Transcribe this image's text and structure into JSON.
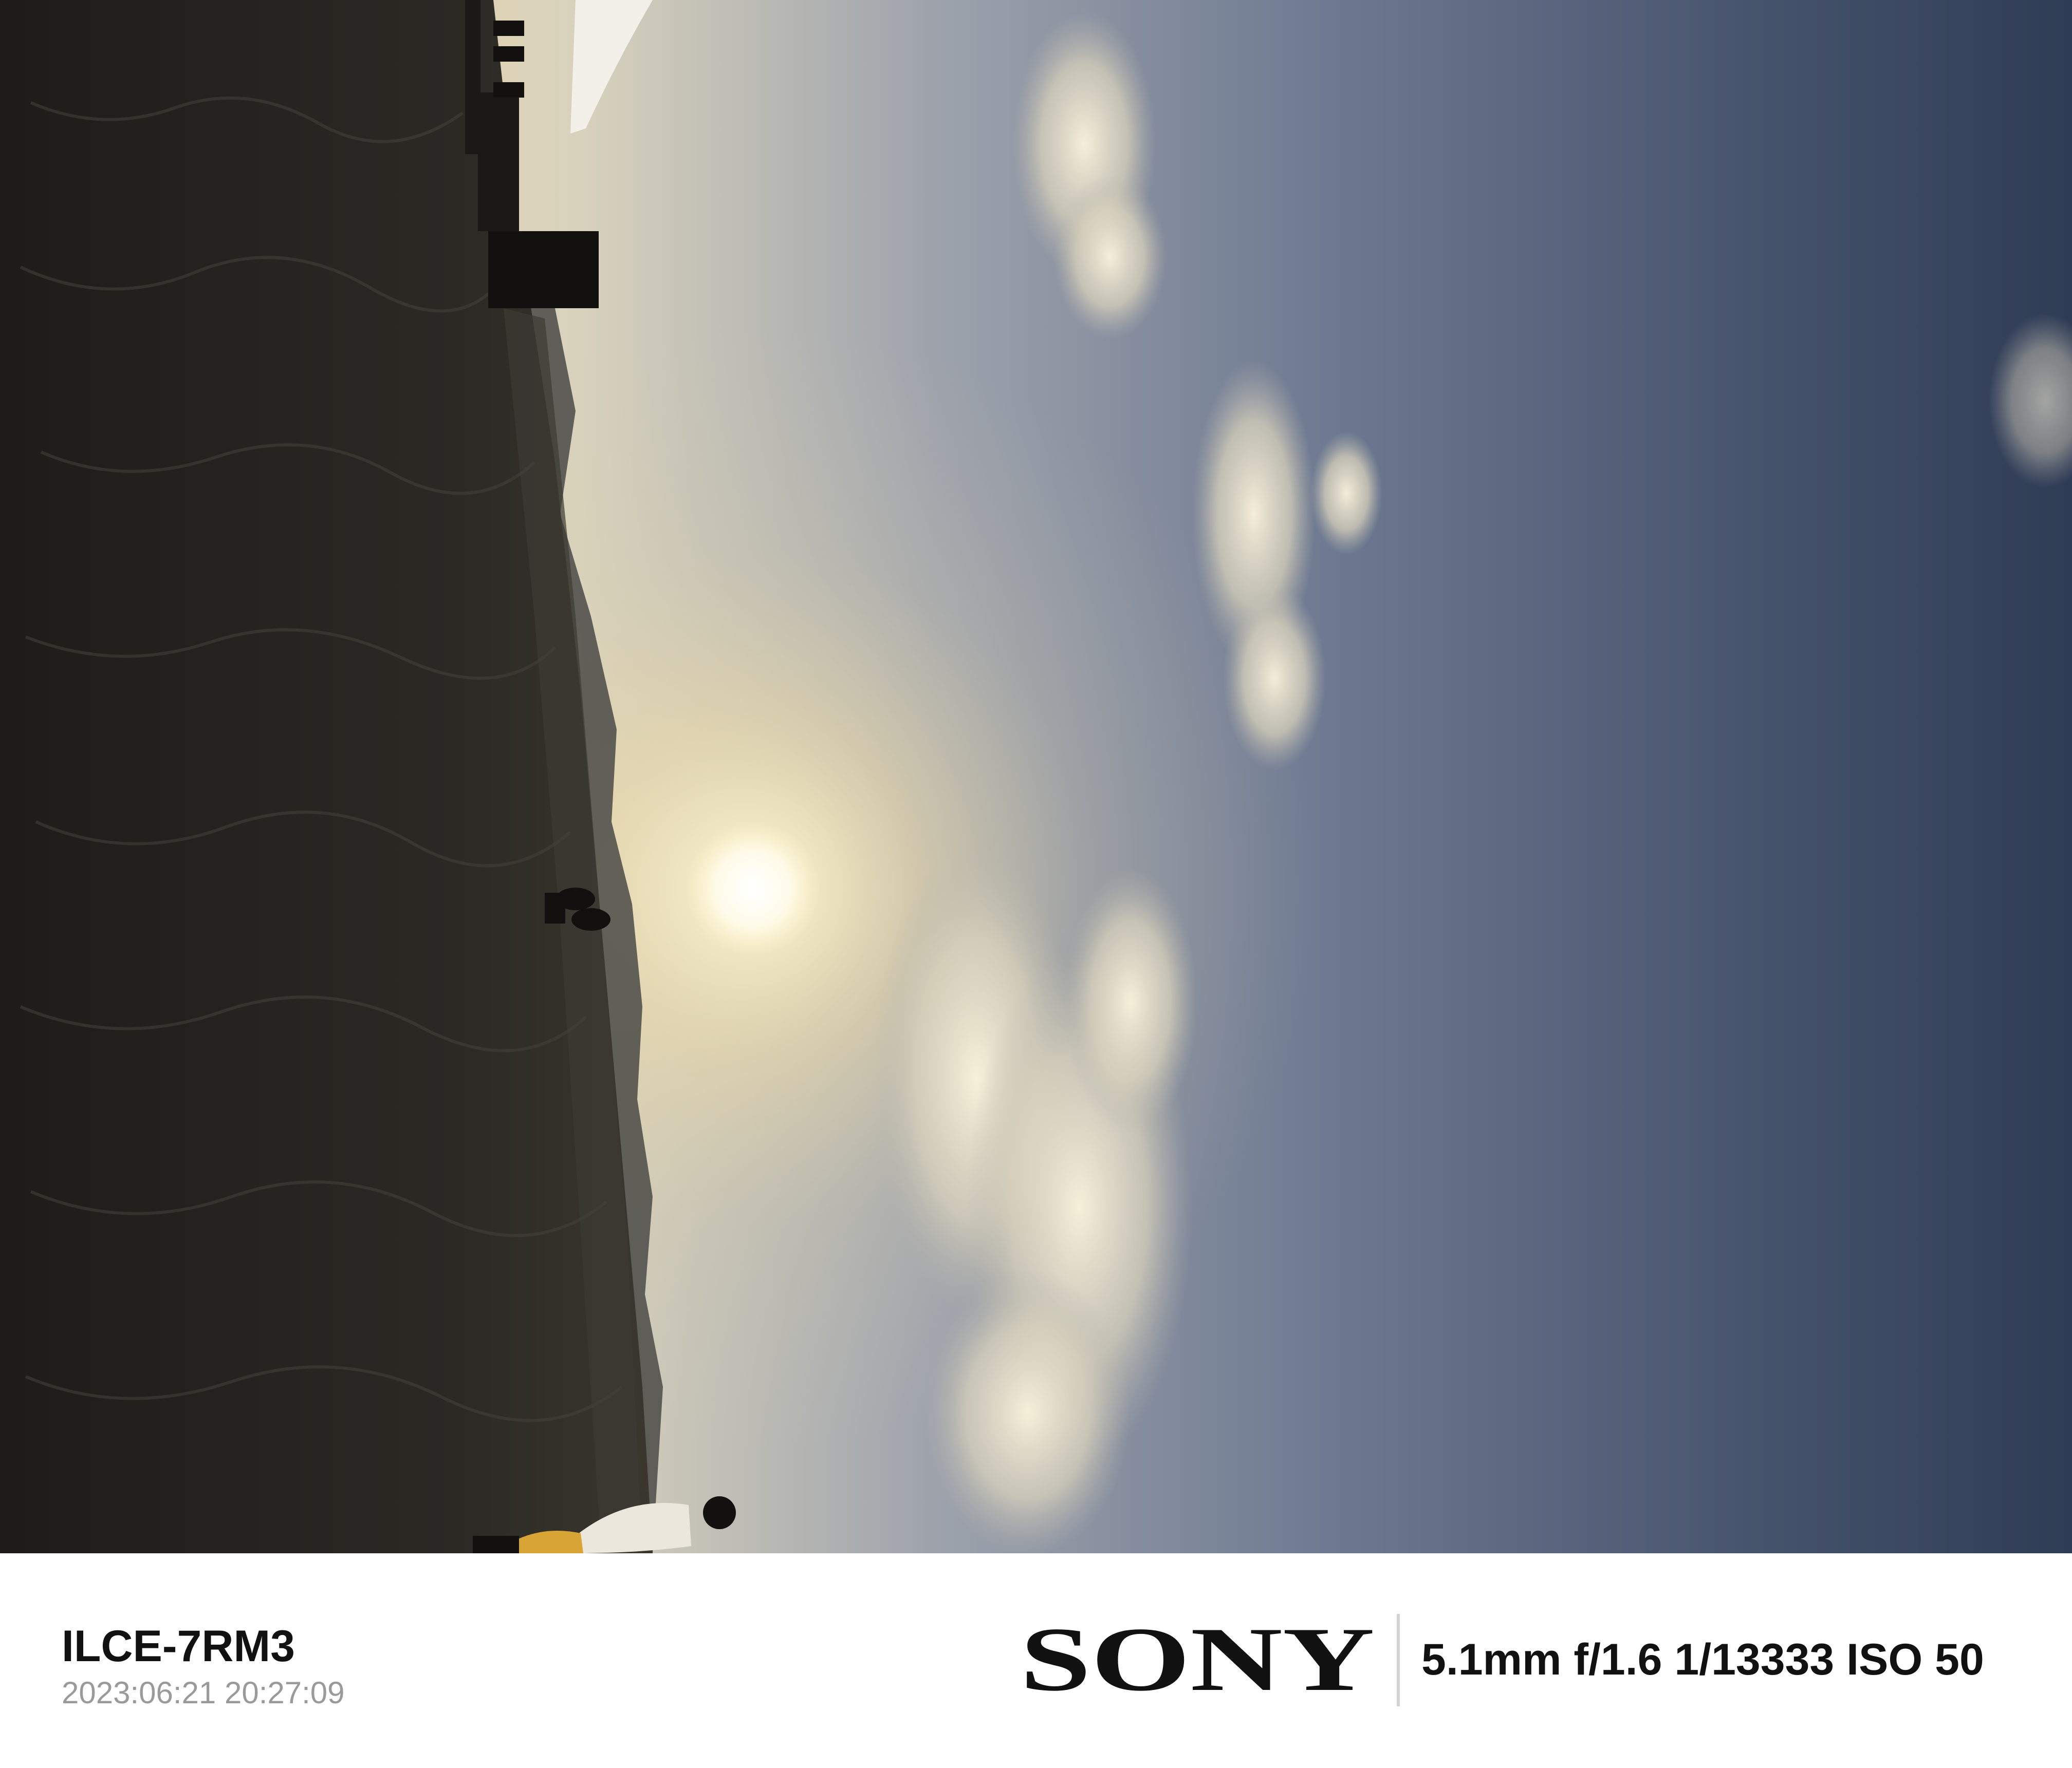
{
  "photo": {
    "scene": "sunset-over-desert-rotated",
    "colors": {
      "sky_dark": "#2d3a52",
      "sky_mid": "#5a6a86",
      "sky_glow": "#e8dcb0",
      "sun": "#fffbe8",
      "ground": "#262420",
      "silhouette": "#121110"
    }
  },
  "footer": {
    "camera_model": "ILCE-7RM3",
    "datetime": "2023:06:21 20:27:09",
    "brand": "SONY",
    "exif": "5.1mm f/1.6 1/13333 ISO 50"
  }
}
